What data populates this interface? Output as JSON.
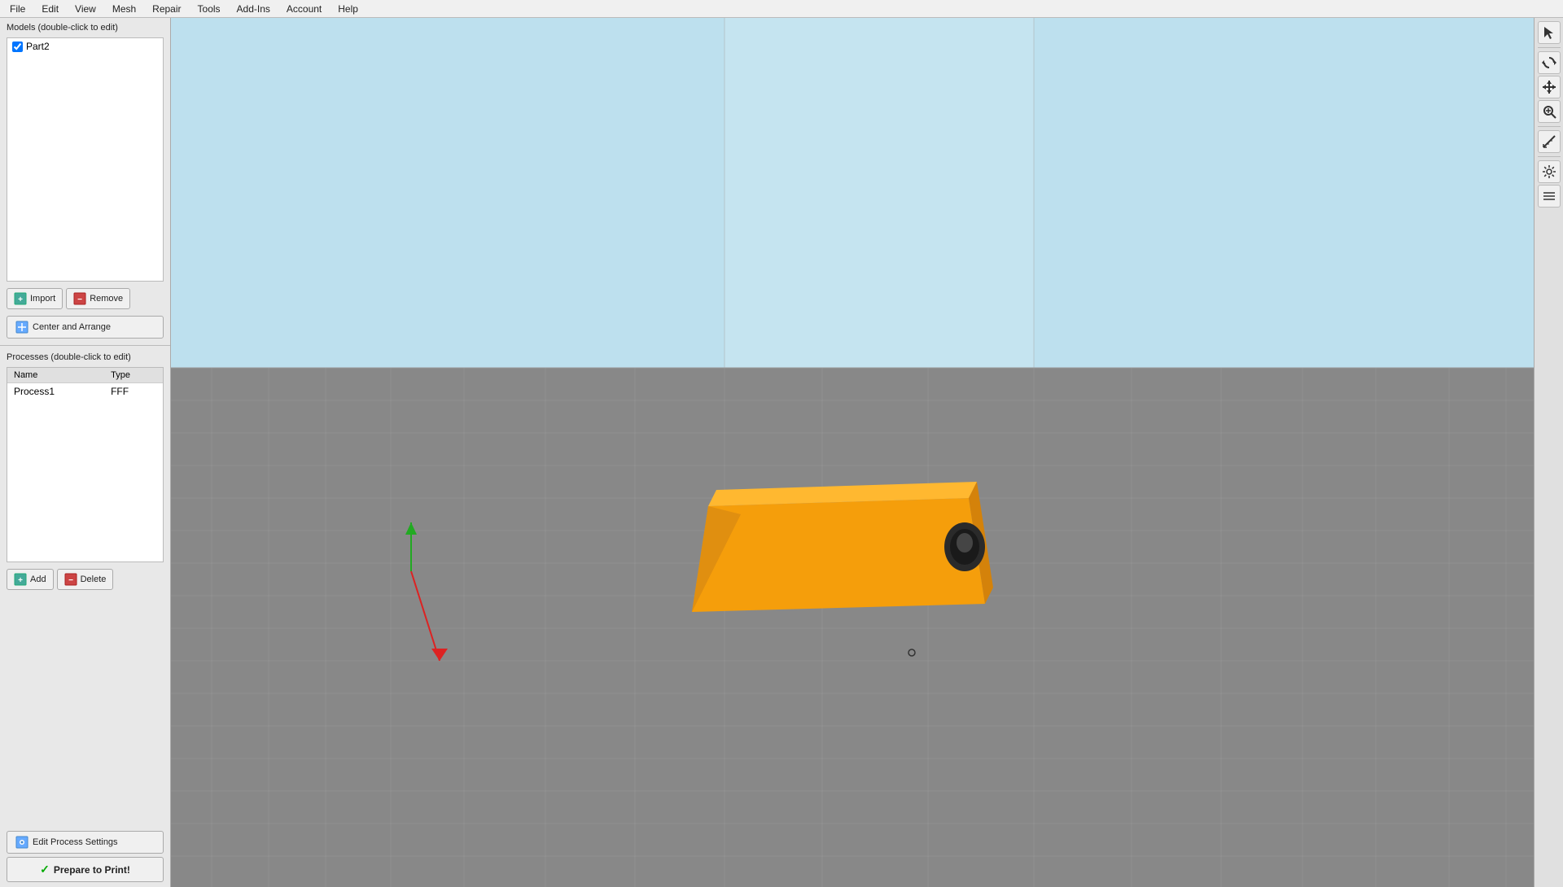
{
  "menubar": {
    "items": [
      "File",
      "Edit",
      "View",
      "Mesh",
      "Repair",
      "Tools",
      "Add-Ins",
      "Account",
      "Help"
    ]
  },
  "left_panel": {
    "models_title": "Models (double-click to edit)",
    "models": [
      {
        "name": "Part2",
        "checked": true
      }
    ],
    "import_button": "Import",
    "remove_button": "Remove",
    "center_arrange_button": "Center and Arrange",
    "processes_title": "Processes (double-click to edit)",
    "processes_columns": [
      "Name",
      "Type"
    ],
    "processes": [
      {
        "name": "Process1",
        "type": "FFF"
      }
    ],
    "add_button": "Add",
    "delete_button": "Delete",
    "edit_process_settings_button": "Edit Process Settings",
    "prepare_button": "Prepare to Print!"
  },
  "right_toolbar": {
    "buttons": [
      {
        "name": "cursor-tool",
        "icon": "↖",
        "label": "Select"
      },
      {
        "name": "rotate-view",
        "icon": "⟳",
        "label": "Rotate"
      },
      {
        "name": "pan-view",
        "icon": "✥",
        "label": "Pan"
      },
      {
        "name": "zoom-view",
        "icon": "⊕",
        "label": "Zoom"
      },
      {
        "name": "measure-tool",
        "icon": "📐",
        "label": "Measure"
      },
      {
        "name": "settings-tool",
        "icon": "⚙",
        "label": "Settings"
      },
      {
        "name": "layers-tool",
        "icon": "☰",
        "label": "Layers"
      }
    ]
  },
  "viewport": {
    "model_color": "#f59e0b",
    "grid_color": "#888888",
    "background_color": "#c8e8f4"
  },
  "colors": {
    "accent_blue": "#0078d4",
    "green_check": "#00aa00",
    "warning_orange": "#f59e0b"
  }
}
